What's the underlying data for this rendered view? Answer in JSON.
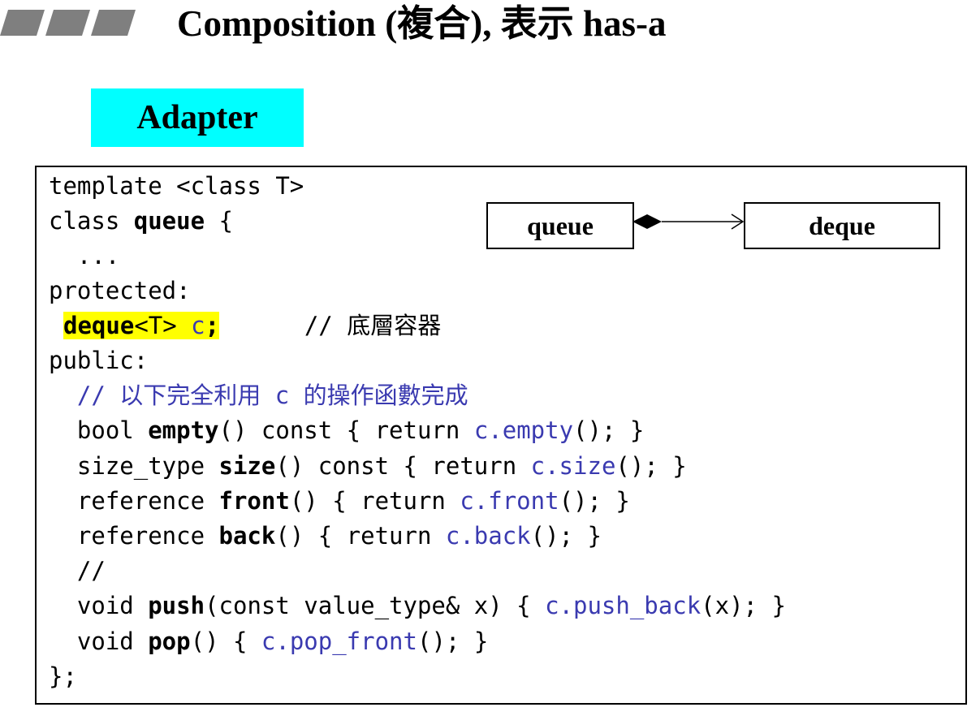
{
  "title": "Composition (複合), 表示 has-a",
  "adapter_label": "Adapter",
  "diagram": {
    "left_box": "queue",
    "right_box": "deque"
  },
  "code": {
    "l1": "template <class T>",
    "l2_kw": "class ",
    "l2_name": "queue",
    "l2_rest": " {",
    "l3": "  ...",
    "l4": "protected:",
    "l5_type": "deque",
    "l5_tmpl": "<T> ",
    "l5_var": "c",
    "l5_semi": ";",
    "l5_comment": "      // 底層容器",
    "l6": "public:",
    "l7": "  // 以下完全利用 c 的操作函數完成",
    "l8_a": "  bool ",
    "l8_b": "empty",
    "l8_c": "() const { return ",
    "l8_d": "c.empty",
    "l8_e": "(); }",
    "l9_a": "  size_type ",
    "l9_b": "size",
    "l9_c": "() const { return ",
    "l9_d": "c.size",
    "l9_e": "(); }",
    "l10_a": "  reference ",
    "l10_b": "front",
    "l10_c": "() { return ",
    "l10_d": "c.front",
    "l10_e": "(); }",
    "l11_a": "  reference ",
    "l11_b": "back",
    "l11_c": "() { return ",
    "l11_d": "c.back",
    "l11_e": "(); }",
    "l12": "  //",
    "l13_a": "  void ",
    "l13_b": "push",
    "l13_c": "(const value_type& x) { ",
    "l13_d": "c.push_back",
    "l13_e": "(x); }",
    "l14_a": "  void ",
    "l14_b": "pop",
    "l14_c": "() { ",
    "l14_d": "c.pop_front",
    "l14_e": "(); }",
    "l15": "};"
  }
}
